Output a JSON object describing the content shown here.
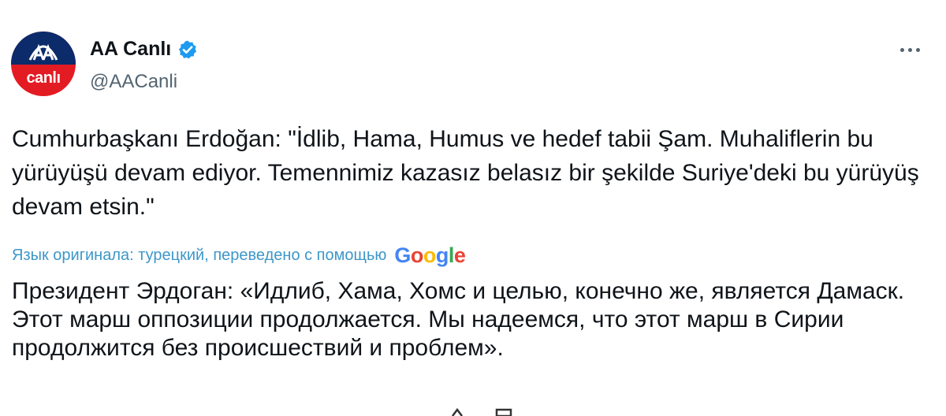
{
  "author": {
    "display_name": "AA Canlı",
    "handle": "@AACanli",
    "avatar_text": "canlı",
    "avatar_logo": "AA",
    "verified": true
  },
  "tweet": {
    "original_text": "Cumhurbaşkanı Erdoğan: \"İdlib, Hama, Humus ve hedef tabii Şam. Muhaliflerin bu yürüyüşü devam ediyor. Temennimiz kazasız belasız bir şekilde Suriye'deki bu yürüyüş devam etsin.\"",
    "translation_note": "Язык оригинала: турецкий, переведено с помощью",
    "translation_provider": "Google",
    "translated_text": "Президент Эрдоган: «Идлиб, Хама, Хомс и целью, конечно же, является Дамаск. Этот марш оппозиции продолжается. Мы надеемся, что этот марш в Сирии продолжится без происшествий и проблем»."
  },
  "colors": {
    "verified_blue": "#1d9bf0",
    "translation_link": "#3d97c8",
    "avatar_red": "#e31b23",
    "avatar_navy": "#0b2b6b"
  },
  "icons": [
    "verified-badge-icon",
    "more-options-icon",
    "aa-logo-icon"
  ]
}
